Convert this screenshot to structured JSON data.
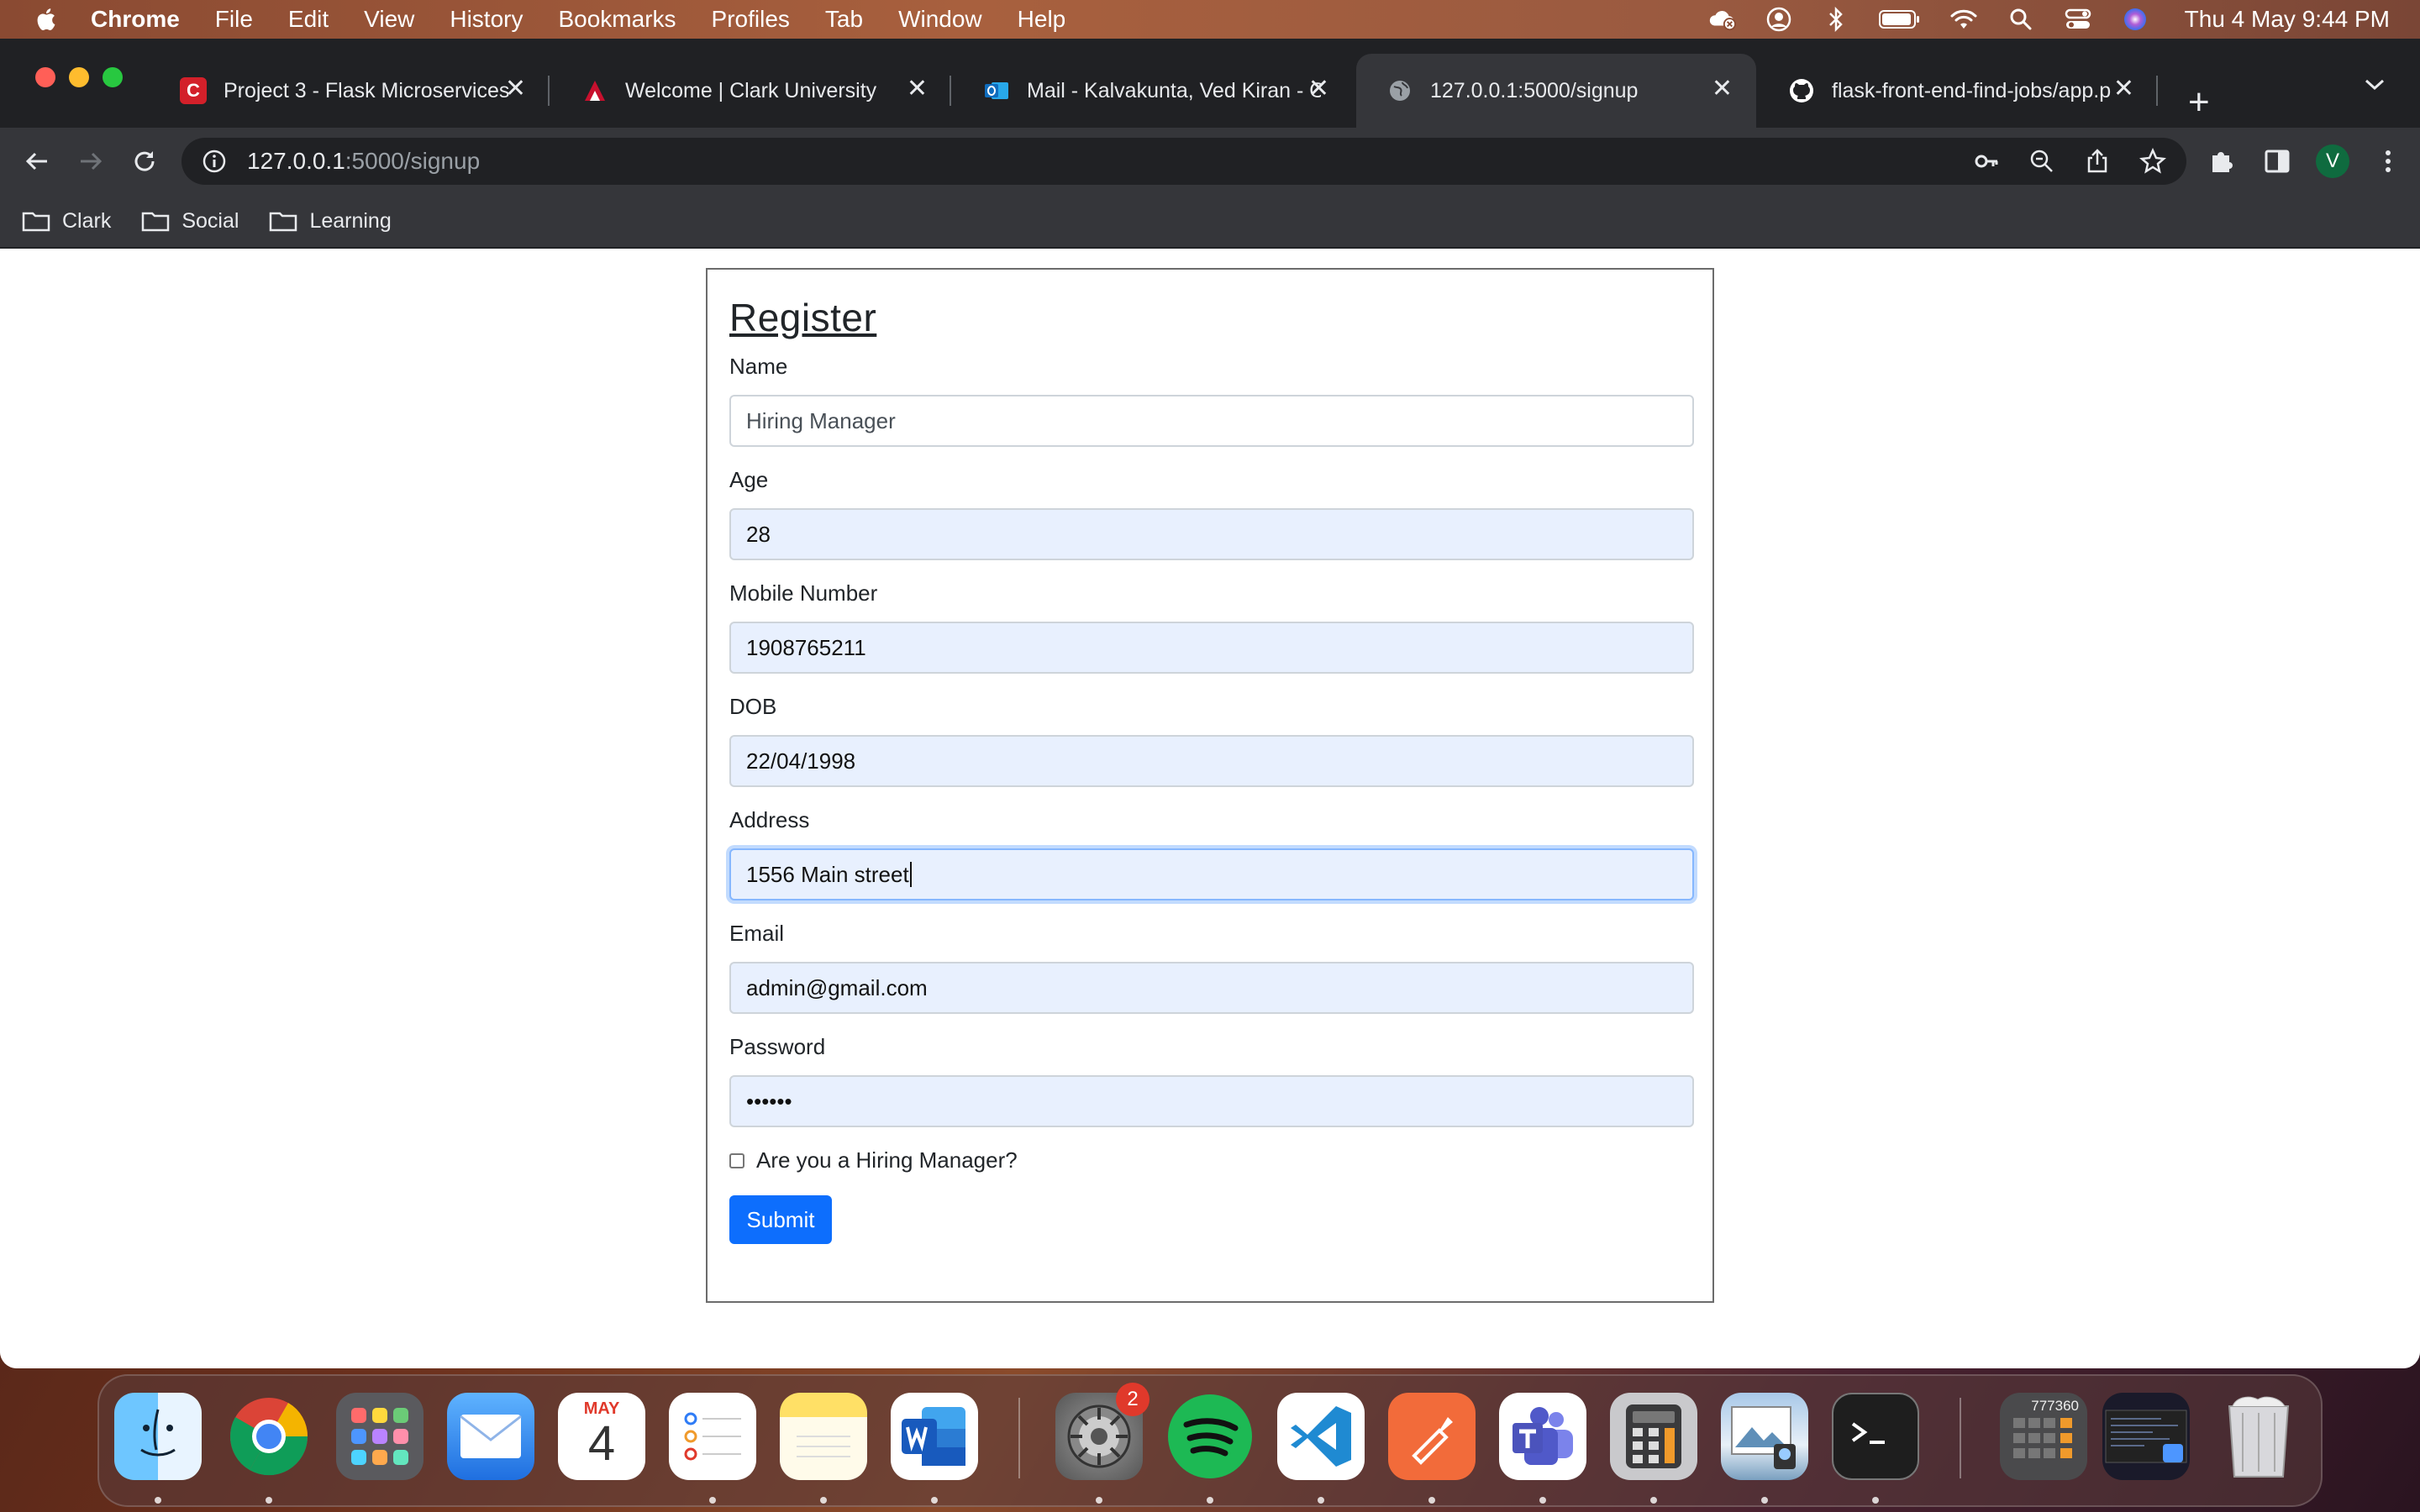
{
  "menubar": {
    "app_name": "Chrome",
    "items": [
      "File",
      "Edit",
      "View",
      "History",
      "Bookmarks",
      "Profiles",
      "Tab",
      "Window",
      "Help"
    ],
    "clock": "Thu 4 May  9:44 PM"
  },
  "tabs": [
    {
      "title": "Project 3 - Flask Microservices",
      "favicon": "C",
      "favicon_color": "#d3202a",
      "active": false
    },
    {
      "title": "Welcome | Clark University",
      "favicon": "clark-logo-icon",
      "favicon_color": "#c8102e",
      "active": false
    },
    {
      "title": "Mail - Kalvakunta, Ved Kiran - O",
      "favicon": "outlook-icon",
      "favicon_color": "#0f6cbd",
      "active": false
    },
    {
      "title": "127.0.0.1:5000/signup",
      "favicon": "globe-icon",
      "favicon_color": "#9aa0a6",
      "active": true
    },
    {
      "title": "flask-front-end-find-jobs/app.p",
      "favicon": "github-icon",
      "favicon_color": "#ffffff",
      "active": false
    }
  ],
  "omnibox": {
    "host": "127.0.0.1",
    "path": ":5000/signup"
  },
  "profile_initial": "V",
  "bookmarks": [
    "Clark",
    "Social",
    "Learning"
  ],
  "form": {
    "title": "Register",
    "fields": {
      "name": {
        "label": "Name",
        "value": "Hiring Manager"
      },
      "age": {
        "label": "Age",
        "value": "28"
      },
      "mobile": {
        "label": "Mobile Number",
        "value": "1908765211"
      },
      "dob": {
        "label": "DOB",
        "value": "22/04/1998"
      },
      "address": {
        "label": "Address",
        "value": "1556 Main street"
      },
      "email": {
        "label": "Email",
        "value": "admin@gmail.com"
      },
      "password": {
        "label": "Password",
        "value": "••••••"
      }
    },
    "checkbox_label": "Are you a Hiring Manager?",
    "submit_label": "Submit"
  },
  "dock": {
    "calendar_month": "MAY",
    "calendar_day": "4",
    "settings_badge": "2",
    "calculator_display": "777360"
  },
  "colors": {
    "accent": "#0d6efd",
    "autofill": "#e8f0fe"
  }
}
